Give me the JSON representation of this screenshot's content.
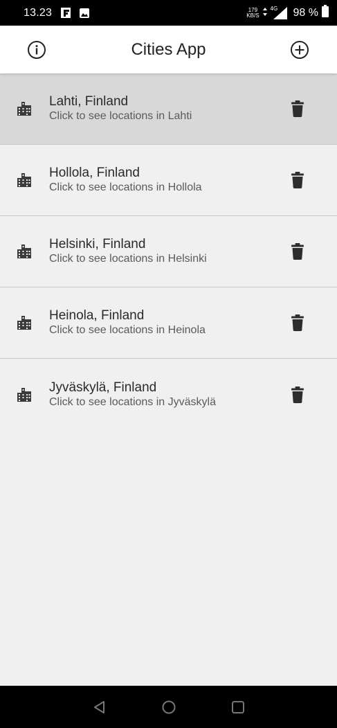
{
  "status_bar": {
    "time": "13.23",
    "net_speed_value": "179",
    "net_speed_unit": "KB/S",
    "network_type": "4G",
    "battery": "98 %"
  },
  "app_bar": {
    "title": "Cities App",
    "left_icon": "info-icon",
    "right_icon": "add-circle-icon"
  },
  "cities": [
    {
      "name": "Lahti, Finland",
      "subtitle": "Click to see locations in Lahti",
      "highlighted": true
    },
    {
      "name": "Hollola, Finland",
      "subtitle": "Click to see locations in Hollola",
      "highlighted": false
    },
    {
      "name": "Helsinki, Finland",
      "subtitle": "Click to see locations in Helsinki",
      "highlighted": false
    },
    {
      "name": "Heinola, Finland",
      "subtitle": "Click to see locations in Heinola",
      "highlighted": false
    },
    {
      "name": "Jyväskylä, Finland",
      "subtitle": "Click to see locations in Jyväskylä",
      "highlighted": false
    }
  ],
  "colors": {
    "highlight_row": "#d8d8d8",
    "background": "#f0f0f0",
    "icon": "#3a3a3a"
  }
}
